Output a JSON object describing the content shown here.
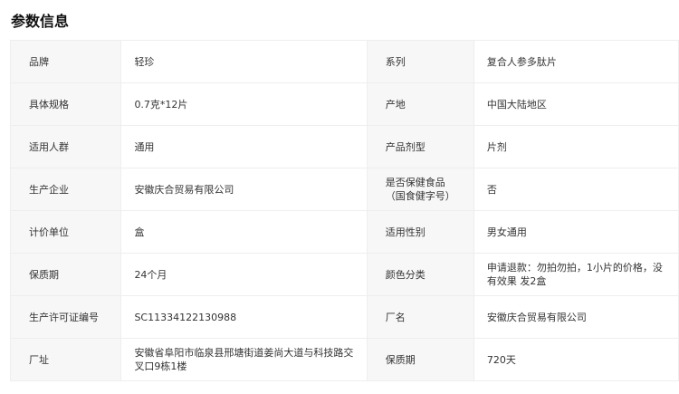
{
  "section": {
    "title": "参数信息"
  },
  "rows": [
    {
      "l1": "品牌",
      "v1": "轻珍",
      "l2": "系列",
      "v2": "复合人参多肽片"
    },
    {
      "l1": "具体规格",
      "v1": "0.7克*12片",
      "l2": "产地",
      "v2": "中国大陆地区"
    },
    {
      "l1": "适用人群",
      "v1": "通用",
      "l2": "产品剂型",
      "v2": "片剂"
    },
    {
      "l1": "生产企业",
      "v1": "安徽庆合贸易有限公司",
      "l2": "是否保健食品（国食健字号）",
      "v2": "否"
    },
    {
      "l1": "计价单位",
      "v1": "盒",
      "l2": "适用性别",
      "v2": "男女通用"
    },
    {
      "l1": "保质期",
      "v1": "24个月",
      "l2": "颜色分类",
      "v2": "申请退款：勿拍勿拍，1小片的价格，没有效果 发2盒"
    },
    {
      "l1": "生产许可证编号",
      "v1": "SC11334122130988",
      "l2": "厂名",
      "v2": "安徽庆合贸易有限公司"
    },
    {
      "l1": "厂址",
      "v1": "安徽省阜阳市临泉县邢塘街道姜尚大道与科技路交叉口9栋1楼",
      "l2": "保质期",
      "v2": "720天"
    }
  ]
}
